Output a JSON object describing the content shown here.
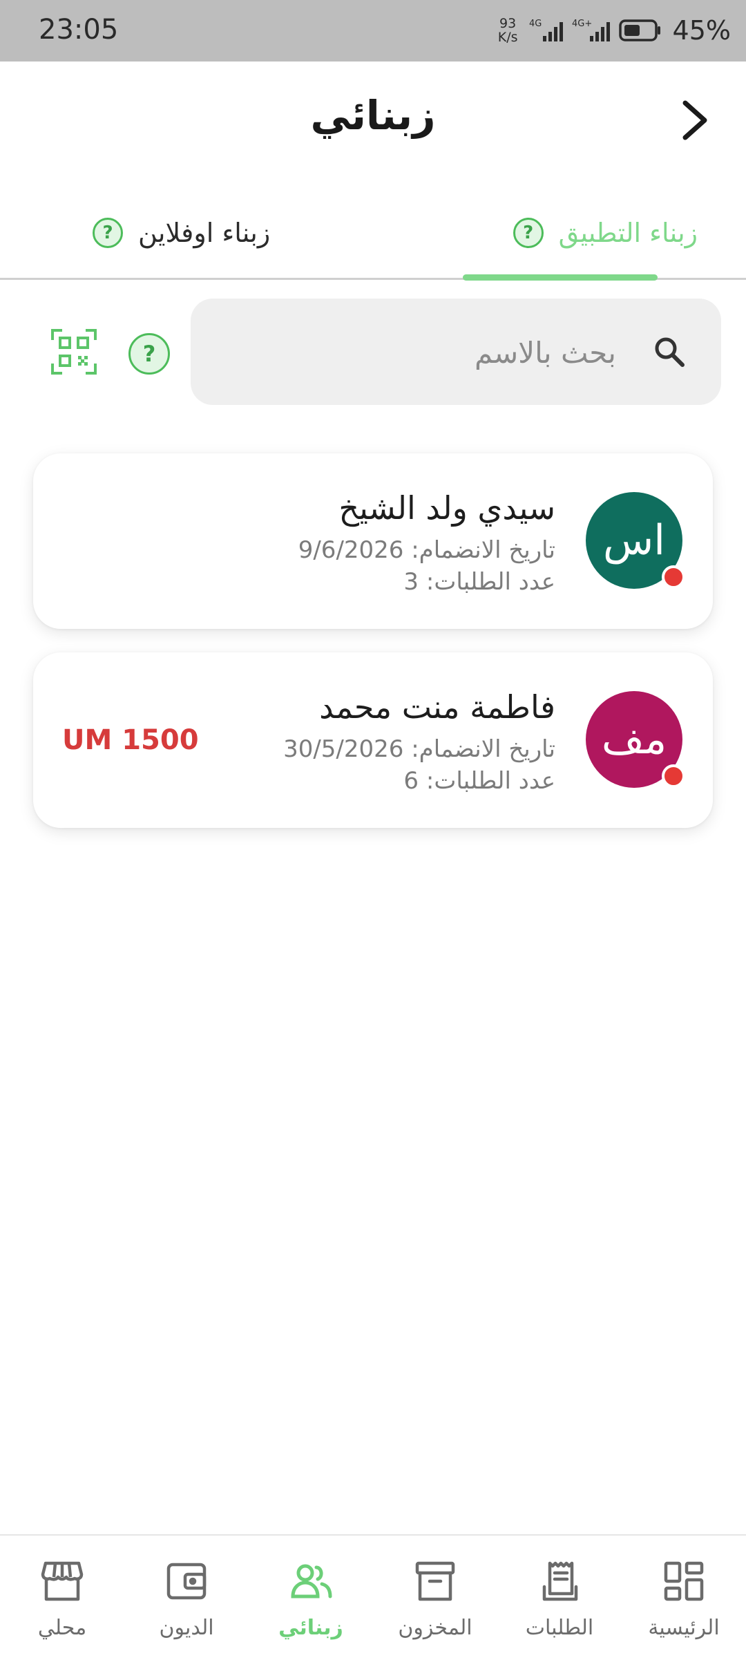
{
  "status_bar": {
    "time": "23:05",
    "net_speed_value": "93",
    "net_speed_unit": "K/s",
    "battery_percent": "45%"
  },
  "header": {
    "title": "زبنائي"
  },
  "tabs": [
    {
      "label": "زبناء التطبيق",
      "active": true
    },
    {
      "label": "زبناء اوفلاين",
      "active": false
    }
  ],
  "search": {
    "placeholder": "بحث بالاسم"
  },
  "help_symbol": "?",
  "customers": [
    {
      "initials": "اس",
      "avatar_color": "#0f6e5e",
      "name": "سيدي ولد الشيخ",
      "joined_line": "تاريخ الانضمام: 9/6/2026",
      "orders_line": "عدد الطلبات: 3",
      "debt": ""
    },
    {
      "initials": "مف",
      "avatar_color": "#b0175e",
      "name": "فاطمة منت محمد",
      "joined_line": "تاريخ الانضمام: 30/5/2026",
      "orders_line": "عدد الطلبات: 6",
      "debt": "UM 1500"
    }
  ],
  "bottom_nav": [
    {
      "label": "الرئيسية",
      "icon": "dashboard-icon",
      "active": false
    },
    {
      "label": "الطلبات",
      "icon": "receipt-icon",
      "active": false
    },
    {
      "label": "المخزون",
      "icon": "archive-box-icon",
      "active": false
    },
    {
      "label": "زبنائي",
      "icon": "people-icon",
      "active": true
    },
    {
      "label": "الديون",
      "icon": "wallet-icon",
      "active": false
    },
    {
      "label": "محلي",
      "icon": "storefront-icon",
      "active": false
    }
  ],
  "colors": {
    "accent_green": "#6ccf78",
    "debt_red": "#d63b3b",
    "online_dot": "#e53935"
  }
}
